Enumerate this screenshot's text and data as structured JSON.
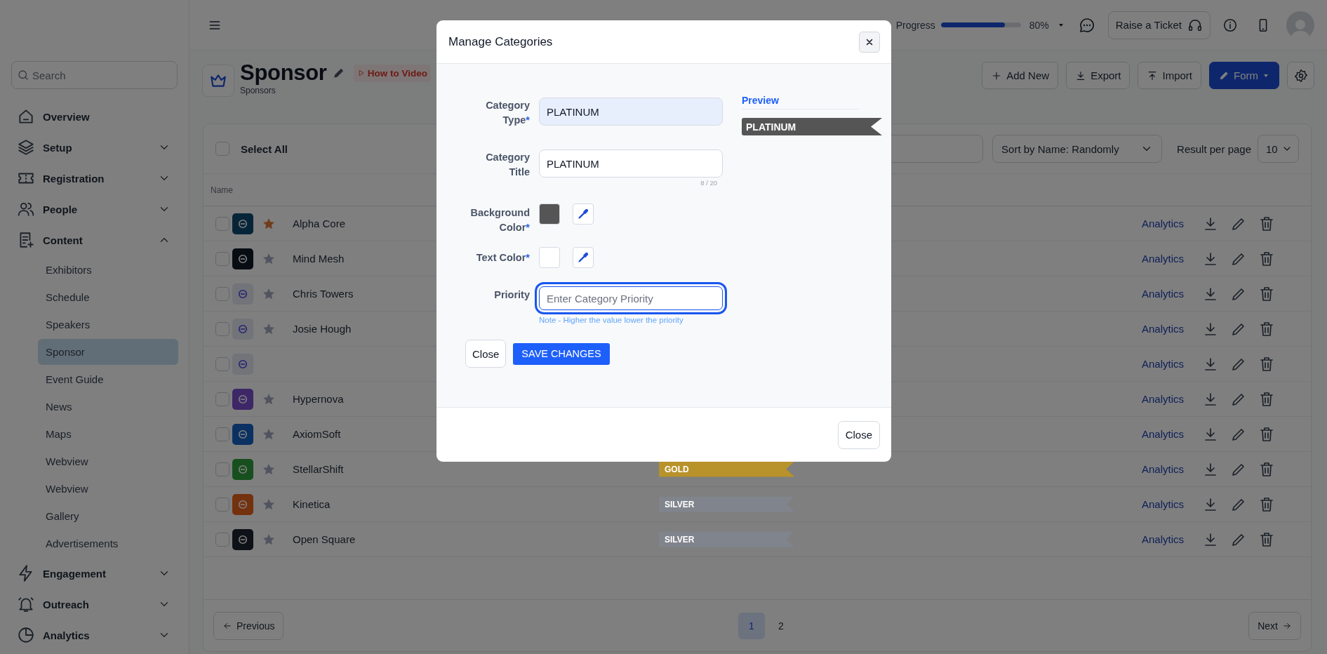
{
  "sidebar": {
    "search": {
      "placeholder": "Search"
    },
    "items": [
      {
        "label": "Overview"
      },
      {
        "label": "Setup",
        "expanded": false
      },
      {
        "label": "Registration",
        "expanded": false
      },
      {
        "label": "People",
        "expanded": false
      },
      {
        "label": "Content",
        "expanded": true,
        "children": [
          {
            "label": "Exhibitors",
            "selected": false
          },
          {
            "label": "Schedule",
            "selected": false
          },
          {
            "label": "Speakers",
            "selected": false
          },
          {
            "label": "Sponsor",
            "selected": true
          },
          {
            "label": "Event Guide",
            "selected": false
          },
          {
            "label": "News",
            "selected": false
          },
          {
            "label": "Maps",
            "selected": false
          },
          {
            "label": "Webview",
            "selected": false
          },
          {
            "label": "Webview",
            "selected": false
          },
          {
            "label": "Gallery",
            "selected": false
          },
          {
            "label": "Advertisements",
            "selected": false
          }
        ]
      },
      {
        "label": "Engagement",
        "expanded": false
      },
      {
        "label": "Outreach",
        "expanded": false
      },
      {
        "label": "Analytics",
        "expanded": false
      }
    ]
  },
  "topbar": {
    "progress": {
      "label": "Progress",
      "level": 0.8,
      "reading": "80%"
    },
    "ticket_button": "Raise a Ticket"
  },
  "page": {
    "title": "Sponsor",
    "subtitle": "Sponsors",
    "video_link": "How to Video",
    "actions": [
      {
        "label": "Add New",
        "kind": "add"
      },
      {
        "label": "Export",
        "kind": "export"
      },
      {
        "label": "Import",
        "kind": "import"
      },
      {
        "label": "Form",
        "kind": "primary"
      }
    ]
  },
  "table": {
    "select_all": {
      "label": "Select All",
      "checked": false
    },
    "sort": "Sort by Name: Randomly",
    "per_page_label": "Result per page",
    "per_page": "10",
    "columns": [
      "Name"
    ],
    "rows": [
      {
        "name": "Alpha Core",
        "starred": true,
        "checked": false,
        "action": "Analytics"
      },
      {
        "name": "Mind Mesh",
        "starred": false,
        "checked": false,
        "action": "Analytics"
      },
      {
        "name": "Chris Towers",
        "starred": false,
        "checked": false,
        "action": "Analytics"
      },
      {
        "name": "Josie Hough",
        "starred": false,
        "checked": false,
        "action": "Analytics"
      },
      {
        "checked": false,
        "action": "Analytics"
      },
      {
        "name": "Hypernova",
        "starred": false,
        "checked": false,
        "action": "Analytics"
      },
      {
        "name": "AxiomSoft",
        "starred": false,
        "checked": false,
        "action": "Analytics"
      },
      {
        "name": "StellarShift",
        "starred": false,
        "checked": false,
        "action": "Analytics",
        "category": {
          "label": "GOLD",
          "color": "#b8922a"
        }
      },
      {
        "name": "Kinetica",
        "starred": false,
        "checked": false,
        "action": "Analytics",
        "category": {
          "label": "SILVER",
          "color": "#80848d"
        }
      },
      {
        "name": "Open Square",
        "starred": false,
        "checked": false,
        "action": "Analytics",
        "category": {
          "label": "SILVER",
          "color": "#80848d"
        }
      }
    ]
  },
  "pagination": {
    "previous": "Previous",
    "next": "Next",
    "pages": [
      {
        "label": "1",
        "selected": true
      },
      {
        "label": "2",
        "selected": false
      }
    ]
  },
  "modal": {
    "title": "Manage Categories",
    "type": {
      "label": "Category Type",
      "required_mark": "*",
      "value": "PLATINUM"
    },
    "title_field": {
      "label": "Category Title",
      "value": "PLATINUM",
      "counter": "8 / 20"
    },
    "background": {
      "label": "Background Color",
      "required_mark": "*",
      "color": "#555555"
    },
    "text_color": {
      "label": "Text Color",
      "required_mark": "*",
      "color": "#ffffff"
    },
    "priority": {
      "label": "Priority",
      "placeholder": "Enter Category Priority",
      "note": "Note - Higher the value lower the priority"
    },
    "preview": {
      "label": "Preview",
      "badge": "PLATINUM"
    },
    "buttons": {
      "close": "Close",
      "save": "SAVE CHANGES",
      "footer_close": "Close"
    }
  }
}
